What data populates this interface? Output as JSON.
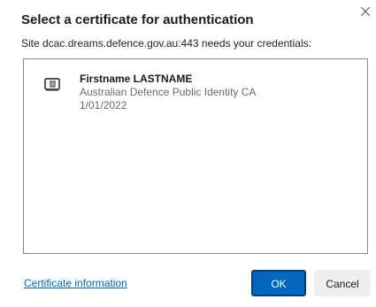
{
  "dialog": {
    "title": "Select a certificate for authentication",
    "subtitle": "Site dcac.dreams.defence.gov.au:443 needs your credentials:",
    "close_icon": "close-icon"
  },
  "certificates": [
    {
      "name": "Firstname LASTNAME",
      "issuer": "Australian Defence Public Identity CA",
      "date": "1/01/2022",
      "icon": "certificate-card-icon"
    }
  ],
  "footer": {
    "info_link": "Certificate information",
    "ok_label": "OK",
    "cancel_label": "Cancel"
  },
  "colors": {
    "accent": "#0067c0",
    "link": "#0066b4",
    "secondary_text": "#6b6b6b"
  }
}
